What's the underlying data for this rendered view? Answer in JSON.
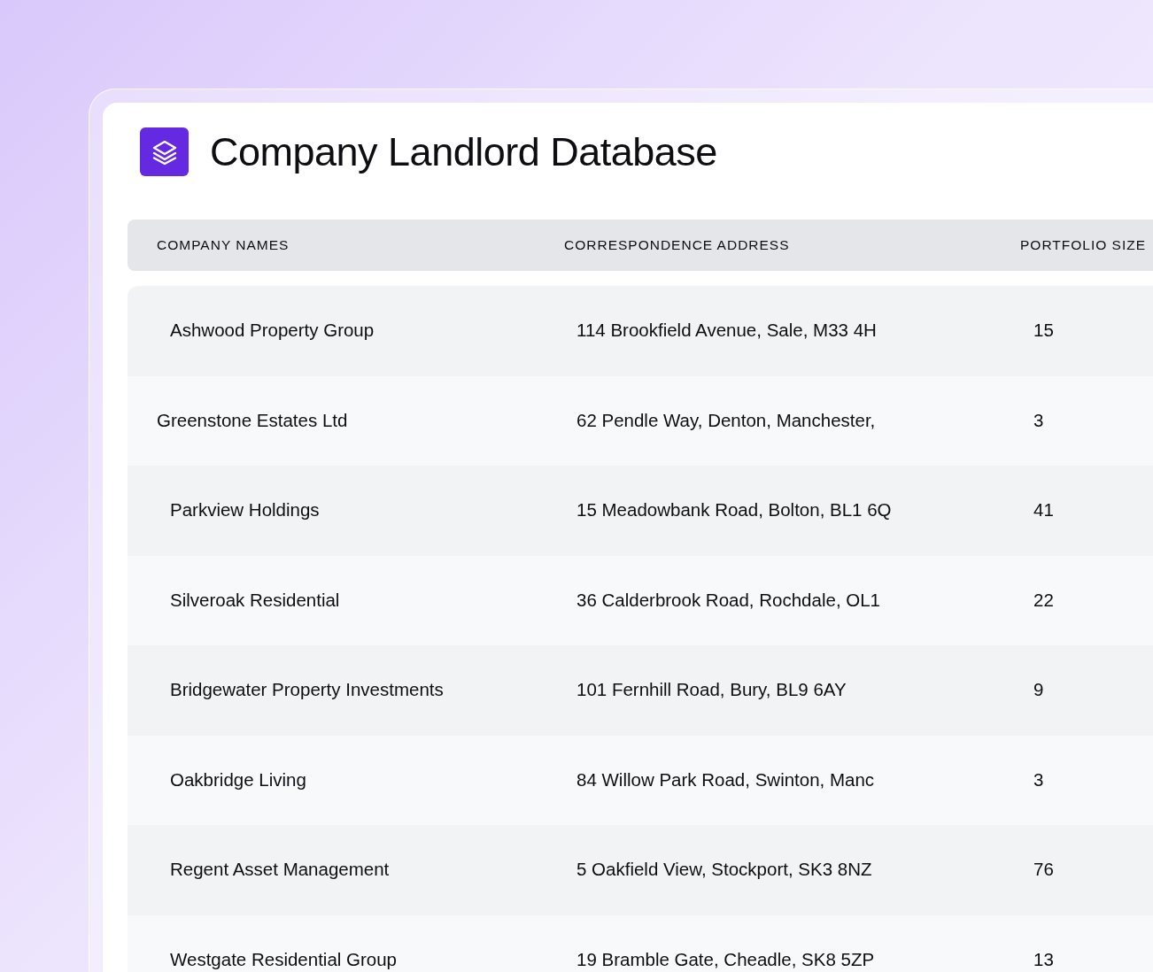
{
  "app": {
    "title": "Company Landlord Database"
  },
  "table": {
    "columns": [
      "COMPANY NAMES",
      "CORRESPONDENCE ADDRESS",
      "PORTFOLIO SIZE"
    ],
    "rows": [
      {
        "name": "Ashwood Property Group",
        "address": "114 Brookfield Avenue, Sale, M33 4H",
        "portfolio_size": "15",
        "indented": true
      },
      {
        "name": "Greenstone Estates Ltd",
        "address": "62 Pendle Way, Denton, Manchester,",
        "portfolio_size": "3",
        "indented": false
      },
      {
        "name": "Parkview Holdings",
        "address": "15 Meadowbank Road, Bolton, BL1 6Q",
        "portfolio_size": "41",
        "indented": true
      },
      {
        "name": "Silveroak Residential",
        "address": "36 Calderbrook Road, Rochdale, OL1",
        "portfolio_size": "22",
        "indented": true
      },
      {
        "name": "Bridgewater Property Investments",
        "address": "101 Fernhill Road, Bury, BL9 6AY",
        "portfolio_size": "9",
        "indented": true
      },
      {
        "name": "Oakbridge Living",
        "address": "84 Willow Park Road, Swinton, Manc",
        "portfolio_size": "3",
        "indented": true
      },
      {
        "name": "Regent Asset Management",
        "address": "5 Oakfield View, Stockport, SK3 8NZ",
        "portfolio_size": "76",
        "indented": true
      },
      {
        "name": "Westgate Residential Group",
        "address": "19 Bramble Gate, Cheadle, SK8 5ZP",
        "portfolio_size": "13",
        "indented": true
      }
    ]
  }
}
